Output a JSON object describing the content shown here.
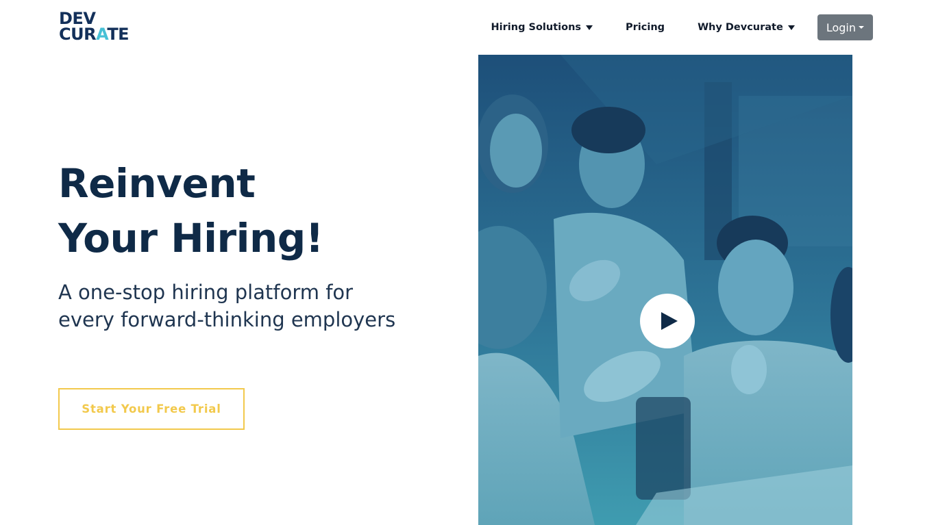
{
  "brand": {
    "logo_line1": "DEV",
    "logo_line2_a": "CUR",
    "logo_line2_b": "A",
    "logo_line2_c": "TE",
    "name_color": "#13305a",
    "accent_color": "#47c1d6"
  },
  "nav": {
    "items": [
      {
        "label": "Hiring Solutions",
        "has_dropdown": true
      },
      {
        "label": "Pricing",
        "has_dropdown": false
      },
      {
        "label": "Why Devcurate",
        "has_dropdown": true
      }
    ],
    "login_label": "Login",
    "login_color": "#6c757d"
  },
  "hero": {
    "title_line1": "Reinvent",
    "title_line2": "Your Hiring!",
    "subtitle": "A one-stop hiring platform for every forward-thinking employers",
    "cta_label": "Start Your Free Trial",
    "cta_color": "#f2c94c",
    "title_color": "#0f2a47"
  },
  "video": {
    "play_icon": "play-icon",
    "overlay_top_color": "#1d4f79",
    "overlay_bottom_color": "#3f9cb0"
  }
}
